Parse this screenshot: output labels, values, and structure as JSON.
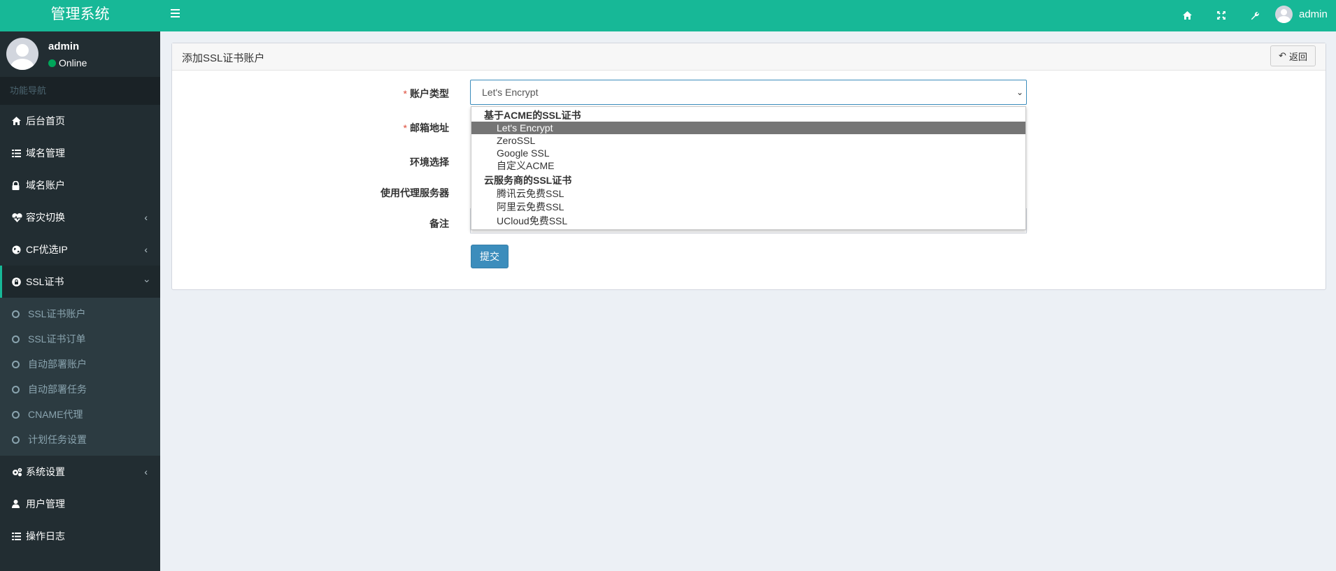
{
  "app": {
    "title": "管理系统"
  },
  "user": {
    "name": "admin",
    "status": "Online"
  },
  "sidebar": {
    "nav_header": "功能导航",
    "items": [
      {
        "label": "后台首页",
        "icon": "home-icon"
      },
      {
        "label": "域名管理",
        "icon": "list-icon"
      },
      {
        "label": "域名账户",
        "icon": "lock-icon"
      },
      {
        "label": "容灾切换",
        "icon": "heartbeat-icon",
        "expandable": true
      },
      {
        "label": "CF优选IP",
        "icon": "globe-icon",
        "expandable": true
      },
      {
        "label": "SSL证书",
        "icon": "lock-circle-icon",
        "expandable": true,
        "expanded": true
      }
    ],
    "ssl_submenu": [
      "SSL证书账户",
      "SSL证书订单",
      "自动部署账户",
      "自动部署任务",
      "CNAME代理",
      "计划任务设置"
    ],
    "bottom_items": [
      {
        "label": "系统设置",
        "icon": "cogs-icon",
        "expandable": true
      },
      {
        "label": "用户管理",
        "icon": "user-icon"
      },
      {
        "label": "操作日志",
        "icon": "list-icon"
      }
    ]
  },
  "header": {
    "user": "admin",
    "icons": [
      "home-icon",
      "fullscreen-icon",
      "wrench-icon"
    ]
  },
  "panel": {
    "title": "添加SSL证书账户",
    "back_label": "返回"
  },
  "form": {
    "account_type_label": "账户类型",
    "email_label": "邮箱地址",
    "env_label": "环境选择",
    "proxy_label": "使用代理服务器",
    "remark_label": "备注",
    "required_mark": "*",
    "account_type_value": "Let's Encrypt",
    "submit_label": "提交"
  },
  "dropdown": {
    "groups": [
      {
        "label": "基于ACME的SSL证书",
        "options": [
          "Let's Encrypt",
          "ZeroSSL",
          "Google SSL",
          "自定义ACME"
        ]
      },
      {
        "label": "云服务商的SSL证书",
        "options": [
          "腾讯云免费SSL",
          "阿里云免费SSL",
          "UCloud免费SSL"
        ]
      }
    ],
    "selected": "Let's Encrypt"
  },
  "colors": {
    "brand": "#17b897",
    "sidebar": "#222d32",
    "primary": "#3c8dbc"
  }
}
